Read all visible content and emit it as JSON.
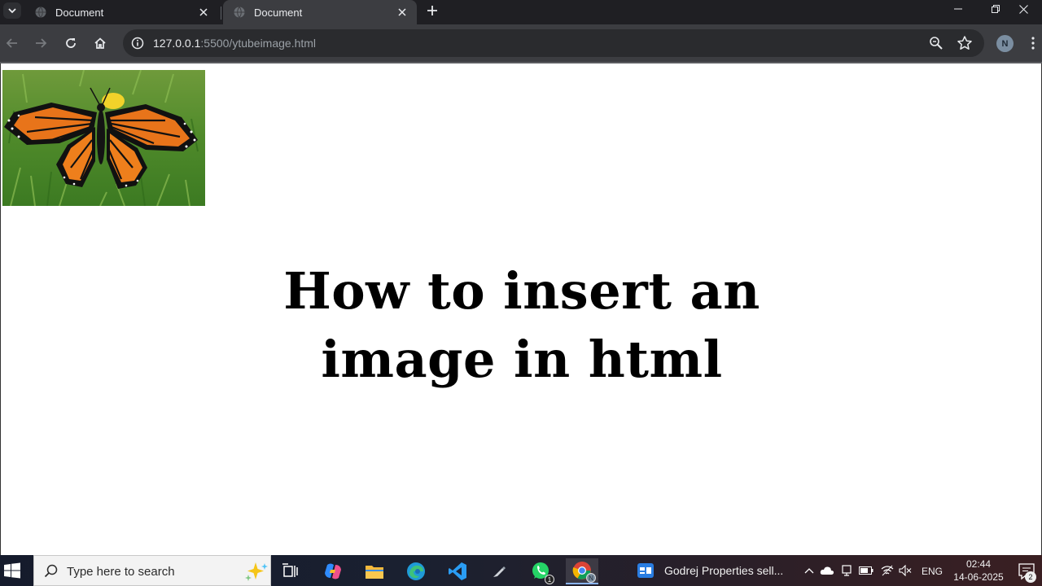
{
  "browser": {
    "tabs": [
      {
        "label": "Document",
        "active": false
      },
      {
        "label": "Document",
        "active": true
      }
    ],
    "address": {
      "host": "127.0.0.1",
      "path": ":5500/ytubeimage.html"
    },
    "profile_initial": "N"
  },
  "page": {
    "image_icon": "monarch-butterfly-image",
    "headline_line1": "How to insert an",
    "headline_line2": "image in html"
  },
  "taskbar": {
    "search_placeholder": "Type here to search",
    "whatsapp_badge": "1",
    "chrome_profile_initial": "N",
    "window_title": "Godrej Properties sell...",
    "language": "ENG",
    "time": "02:44",
    "date": "14-06-2025",
    "notification_count": "2"
  },
  "colors": {
    "tabstrip_bg": "#1f1f23",
    "toolbar_bg": "#3c3d41",
    "omnibox_bg": "#2a2b2e",
    "page_bg": "#ffffff",
    "headline": "#000000"
  }
}
